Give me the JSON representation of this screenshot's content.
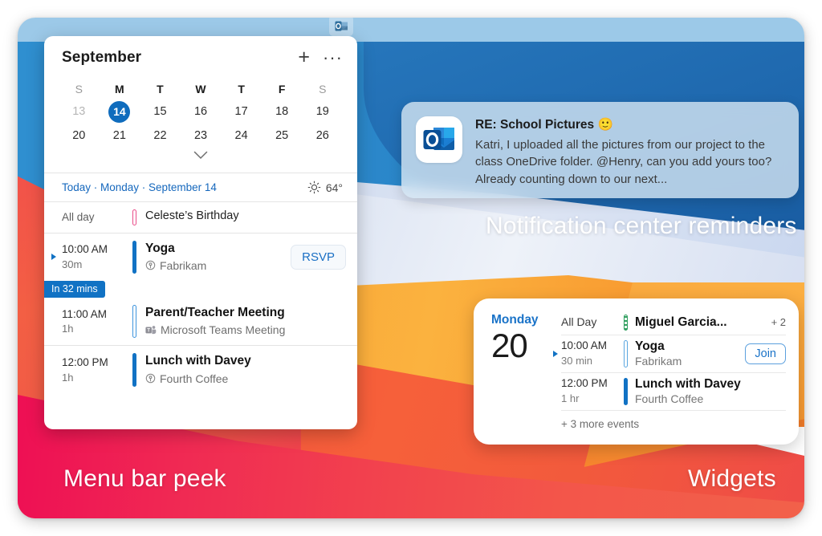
{
  "menubar": {
    "icon": "outlook-icon"
  },
  "peek": {
    "month": "September",
    "add_label": "+",
    "more_label": "···",
    "dow": [
      "S",
      "M",
      "T",
      "W",
      "T",
      "F",
      "S"
    ],
    "weeks": [
      [
        {
          "n": "13",
          "state": "other"
        },
        {
          "n": "14",
          "state": "today"
        },
        {
          "n": "15",
          "state": "normal"
        },
        {
          "n": "16",
          "state": "normal"
        },
        {
          "n": "17",
          "state": "normal"
        },
        {
          "n": "18",
          "state": "normal"
        },
        {
          "n": "19",
          "state": "normal"
        }
      ],
      [
        {
          "n": "20",
          "state": "normal"
        },
        {
          "n": "21",
          "state": "normal"
        },
        {
          "n": "22",
          "state": "normal"
        },
        {
          "n": "23",
          "state": "normal"
        },
        {
          "n": "24",
          "state": "normal"
        },
        {
          "n": "25",
          "state": "normal"
        },
        {
          "n": "26",
          "state": "normal"
        }
      ]
    ],
    "today_line": "Today · Monday · September 14",
    "weather": {
      "icon": "sun-icon",
      "temp": "64°"
    },
    "now_badge": "In 32 mins",
    "events": [
      {
        "time": "All day",
        "duration": "",
        "title": "Celeste’s Birthday",
        "sub": "",
        "sub_icon": "",
        "bar": "hollow-pink",
        "action": "",
        "allday": true,
        "now": false
      },
      {
        "time": "10:00 AM",
        "duration": "30m",
        "title": "Yoga",
        "sub": "Fabrikam",
        "sub_icon": "location-icon",
        "bar": "solid-blue",
        "action": "RSVP",
        "allday": false,
        "now": true
      },
      {
        "time": "11:00 AM",
        "duration": "1h",
        "title": "Parent/Teacher Meeting",
        "sub": "Microsoft Teams Meeting",
        "sub_icon": "teams-icon",
        "bar": "hollow-blue",
        "action": "",
        "allday": false,
        "now": false
      },
      {
        "time": "12:00 PM",
        "duration": "1h",
        "title": "Lunch with Davey",
        "sub": "Fourth Coffee",
        "sub_icon": "location-icon",
        "bar": "solid-blue",
        "action": "",
        "allday": false,
        "now": false
      }
    ]
  },
  "notification": {
    "app_icon": "outlook-icon",
    "title": "RE: School Pictures 🙂",
    "body": "Katri, I uploaded all the pictures from our project to the class OneDrive folder. @Henry, can you add yours too? Already counting down to our next..."
  },
  "widget": {
    "dow": "Monday",
    "day": "20",
    "rows": [
      {
        "time": "All Day",
        "duration": "",
        "title": "Miguel Garcia...",
        "sub": "",
        "bar": "striped-green",
        "trailing": "+ 2",
        "trailing_type": "count"
      },
      {
        "time": "10:00 AM",
        "duration": "30 min",
        "title": "Yoga",
        "sub": "Fabrikam",
        "bar": "hollow-blue",
        "trailing": "Join",
        "trailing_type": "button"
      },
      {
        "time": "12:00 PM",
        "duration": "1 hr",
        "title": "Lunch with Davey",
        "sub": "Fourth Coffee",
        "bar": "solid-blue",
        "trailing": "",
        "trailing_type": ""
      }
    ],
    "more": "+ 3 more events"
  },
  "captions": {
    "notification": "Notification center reminders",
    "peek": "Menu bar peek",
    "widgets": "Widgets"
  },
  "colors": {
    "accent_blue": "#1172c4",
    "link_blue": "#1668bd",
    "pink_bar": "#ea4c89",
    "green_bar": "#2f9e5e"
  }
}
